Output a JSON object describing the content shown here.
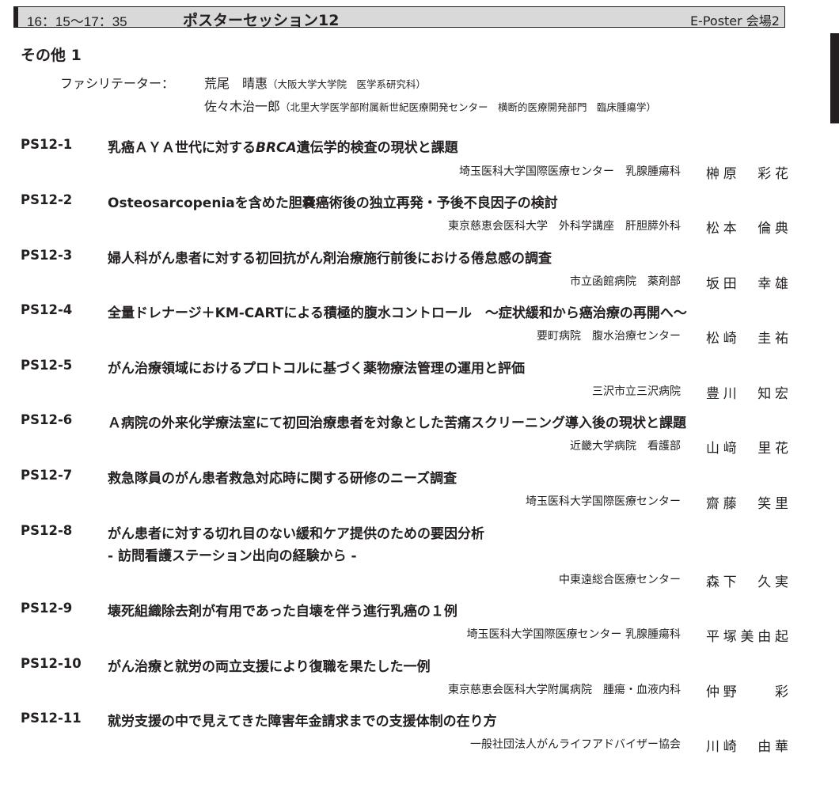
{
  "header": {
    "time": "16：15〜17：35",
    "title": "ポスターセッション12",
    "venue": "E-Poster 会場2"
  },
  "section": {
    "title": "その他 1"
  },
  "facilitators": {
    "label": "ファシリテーター：",
    "people": [
      {
        "name": "荒尾　晴惠",
        "affiliation": "（大阪大学大学院　医学系研究科）"
      },
      {
        "name": "佐々木治一郎",
        "affiliation": "（北里大学医学部附属新世紀医療開発センター　横断的医療開発部門　臨床腫瘍学）"
      }
    ]
  },
  "presentations": [
    {
      "id": "PS12-1",
      "title_pre": "乳癌ＡＹＡ世代に対する",
      "title_italic": "BRCA",
      "title_post": "遺伝学的検査の現状と課題",
      "affiliation": "埼玉医科大学国際医療センター　乳腺腫瘍科",
      "presenter": "榊原　彩花"
    },
    {
      "id": "PS12-2",
      "title": "Osteosarcopeniaを含めた胆嚢癌術後の独立再発・予後不良因子の検討",
      "affiliation": "東京慈恵会医科大学　外科学講座　肝胆膵外科",
      "presenter": "松本　倫典"
    },
    {
      "id": "PS12-3",
      "title": "婦人科がん患者に対する初回抗がん剤治療施行前後における倦怠感の調査",
      "affiliation": "市立函館病院　薬剤部",
      "presenter": "坂田　幸雄"
    },
    {
      "id": "PS12-4",
      "title": "全量ドレナージ＋KM-CARTによる積極的腹水コントロール　〜症状緩和から癌治療の再開へ〜",
      "affiliation": "要町病院　腹水治療センター",
      "presenter": "松崎　圭祐"
    },
    {
      "id": "PS12-5",
      "title": "がん治療領域におけるプロトコルに基づく薬物療法管理の運用と評価",
      "affiliation": "三沢市立三沢病院",
      "presenter": "豊川　知宏"
    },
    {
      "id": "PS12-6",
      "title": "Ａ病院の外来化学療法室にて初回治療患者を対象とした苦痛スクリーニング導入後の現状と課題",
      "affiliation": "近畿大学病院　看護部",
      "presenter": "山﨑　里花"
    },
    {
      "id": "PS12-7",
      "title": "救急隊員のがん患者救急対応時に関する研修のニーズ調査",
      "affiliation": "埼玉医科大学国際医療センター",
      "presenter": "齋藤　笑里"
    },
    {
      "id": "PS12-8",
      "title": "がん患者に対する切れ目のない緩和ケア提供のための要因分析",
      "subtitle": "- 訪問看護ステーション出向の経験から -",
      "affiliation": "中東遠総合医療センター",
      "presenter": "森下　久実"
    },
    {
      "id": "PS12-9",
      "title": "壊死組織除去剤が有用であった自壊を伴う進行乳癌の１例",
      "affiliation": "埼玉医科大学国際医療センター 乳腺腫瘍科",
      "presenter": "平塚美由起"
    },
    {
      "id": "PS12-10",
      "title": "がん治療と就労の両立支援により復職を果たした一例",
      "affiliation": "東京慈恵会医科大学附属病院　腫瘍・血液内科",
      "presenter": "仲野　　彩"
    },
    {
      "id": "PS12-11",
      "title": "就労支援の中で見えてきた障害年金請求までの支援体制の在り方",
      "affiliation": "一般社団法人がんライフアドバイザー協会",
      "presenter": "川崎　由華"
    }
  ]
}
